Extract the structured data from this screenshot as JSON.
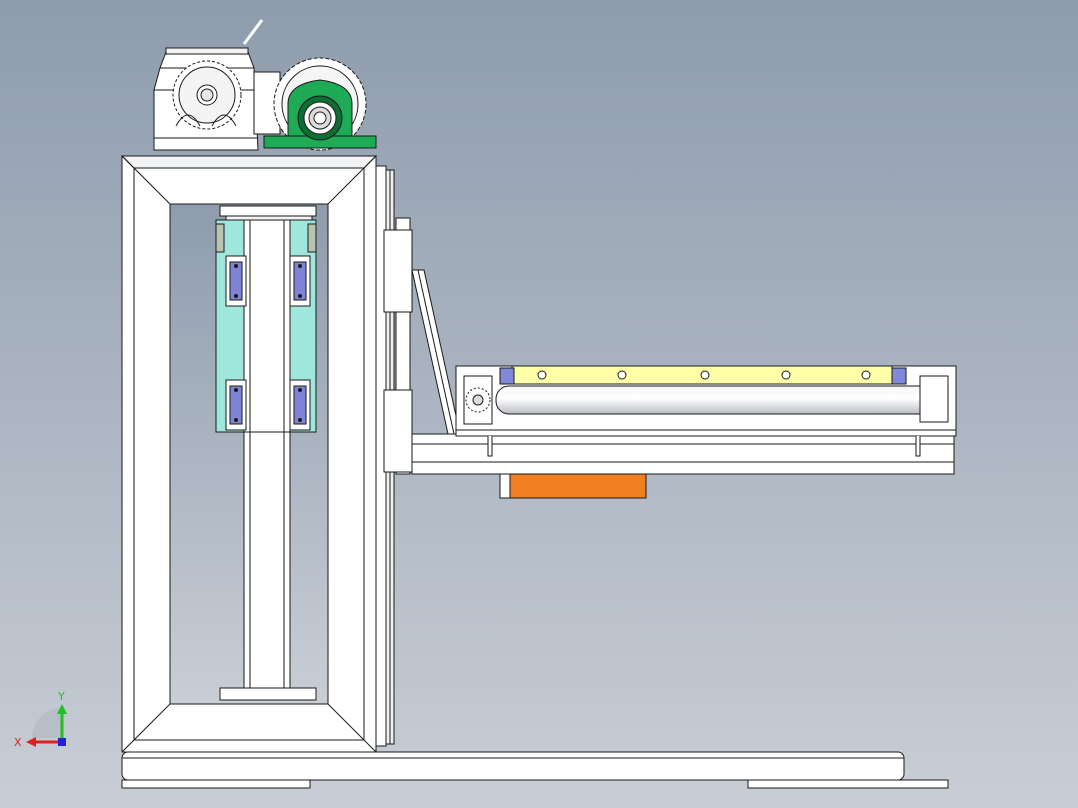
{
  "viewport": {
    "background_top": "#8e9cad",
    "background_bottom": "#c9ced6"
  },
  "triad": {
    "x_label": "X",
    "y_label": "Y",
    "x_color": "#e0201c",
    "y_color": "#20c020",
    "z_color": "#2020e0"
  },
  "colors": {
    "line": "#1a1a1a",
    "steel": "#ffffff",
    "steel_shade": "#e4e6e8",
    "bearing_housing": "#1faa55",
    "bearing_dark": "#0b6e33",
    "guide_block": "#9fe6dc",
    "guide_carriage": "#7f85d6",
    "rail_yellow": "#ffffa8",
    "roller": "#d9dce0",
    "motor_orange": "#f08020",
    "end_cap": "#8088d8"
  }
}
